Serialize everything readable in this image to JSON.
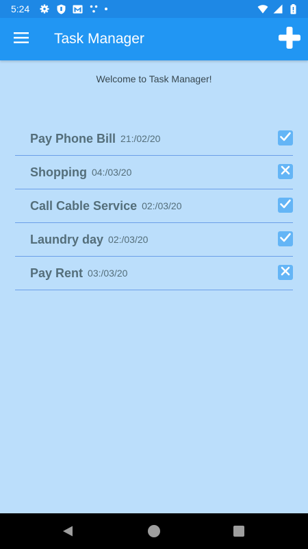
{
  "status_bar": {
    "time": "5:24",
    "left_icons": [
      "gear-icon",
      "shield-icon",
      "gmail-icon",
      "dots-icon",
      "dot-icon"
    ],
    "right_icons": [
      "wifi-icon",
      "signal-icon",
      "battery-icon"
    ]
  },
  "app_bar": {
    "title": "Task Manager",
    "menu_icon": "hamburger-menu-icon",
    "add_icon": "plus-icon",
    "background": "#2196f3"
  },
  "welcome_text": "Welcome to Task Manager!",
  "tasks": [
    {
      "name": "Pay Phone Bill",
      "date": "21:/02/20",
      "status_icon": "check-icon"
    },
    {
      "name": "Shopping",
      "date": "04:/03/20",
      "status_icon": "x-icon"
    },
    {
      "name": "Call Cable Service",
      "date": "02:/03/20",
      "status_icon": "check-icon"
    },
    {
      "name": "Laundry day",
      "date": "02:/03/20",
      "status_icon": "check-icon"
    },
    {
      "name": "Pay Rent",
      "date": "03:/03/20",
      "status_icon": "x-icon"
    }
  ],
  "nav_bar": {
    "buttons": [
      "back-icon",
      "home-icon",
      "recents-icon"
    ]
  },
  "colors": {
    "status_bar": "#1e88e5",
    "page_background": "#bbdefb",
    "checkbox": "#64b5f6",
    "divider": "#6b9fe8"
  }
}
